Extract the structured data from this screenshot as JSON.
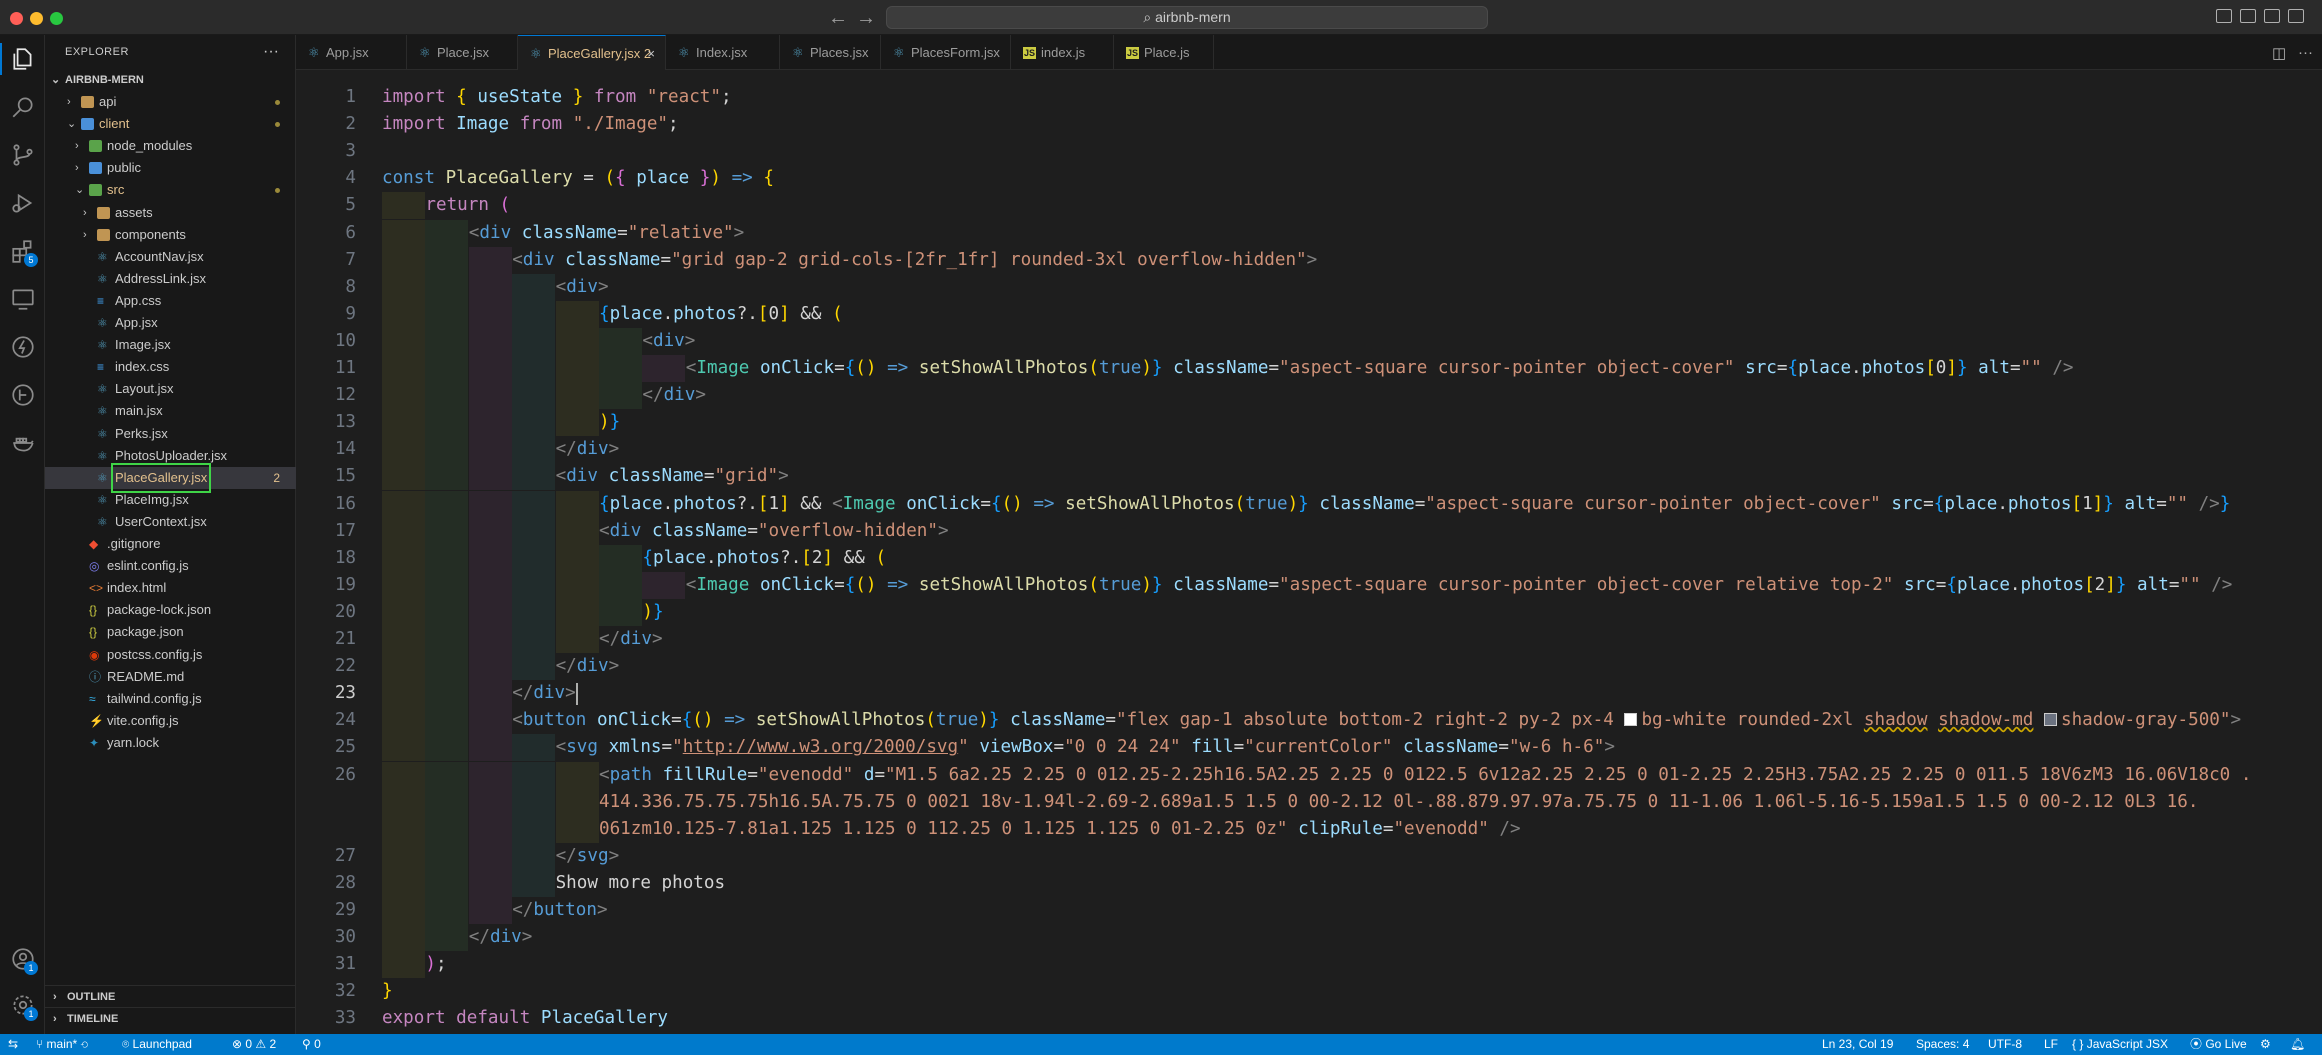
{
  "window": {
    "search_text": "airbnb-mern"
  },
  "activity_bar": {
    "extensions_badge": "5",
    "accounts_badge": "1",
    "settings_badge": "1"
  },
  "sidebar": {
    "title": "EXPLORER",
    "root": "AIRBNB-MERN",
    "tree": [
      {
        "label": "api",
        "kind": "folder",
        "color": "folder",
        "depth": 1,
        "chev": "›",
        "dot": true
      },
      {
        "label": "client",
        "kind": "folder",
        "color": "folder-blue",
        "depth": 1,
        "chev": "⌄",
        "dot": true,
        "mod": true
      },
      {
        "label": "node_modules",
        "kind": "folder",
        "color": "folder-green",
        "depth": 2,
        "chev": "›"
      },
      {
        "label": "public",
        "kind": "folder",
        "color": "folder-blue",
        "depth": 2,
        "chev": "›"
      },
      {
        "label": "src",
        "kind": "folder",
        "color": "folder-green",
        "depth": 2,
        "chev": "⌄",
        "dot": true,
        "mod": true
      },
      {
        "label": "assets",
        "kind": "folder",
        "color": "folder",
        "depth": 3,
        "chev": "›"
      },
      {
        "label": "components",
        "kind": "folder",
        "color": "folder",
        "depth": 3,
        "chev": "›"
      },
      {
        "label": "AccountNav.jsx",
        "kind": "react",
        "depth": 3
      },
      {
        "label": "AddressLink.jsx",
        "kind": "react",
        "depth": 3
      },
      {
        "label": "App.css",
        "kind": "css",
        "depth": 3
      },
      {
        "label": "App.jsx",
        "kind": "react",
        "depth": 3
      },
      {
        "label": "Image.jsx",
        "kind": "react",
        "depth": 3
      },
      {
        "label": "index.css",
        "kind": "css",
        "depth": 3
      },
      {
        "label": "Layout.jsx",
        "kind": "react",
        "depth": 3
      },
      {
        "label": "main.jsx",
        "kind": "react",
        "depth": 3
      },
      {
        "label": "Perks.jsx",
        "kind": "react",
        "depth": 3
      },
      {
        "label": "PhotosUploader.jsx",
        "kind": "react",
        "depth": 3
      },
      {
        "label": "PlaceGallery.jsx",
        "kind": "react",
        "depth": 3,
        "selected": true,
        "count": "2"
      },
      {
        "label": "PlaceImg.jsx",
        "kind": "react",
        "depth": 3
      },
      {
        "label": "UserContext.jsx",
        "kind": "react",
        "depth": 3
      },
      {
        "label": ".gitignore",
        "kind": "git",
        "depth": 2
      },
      {
        "label": "eslint.config.js",
        "kind": "eslint",
        "depth": 2
      },
      {
        "label": "index.html",
        "kind": "html",
        "depth": 2
      },
      {
        "label": "package-lock.json",
        "kind": "json",
        "depth": 2
      },
      {
        "label": "package.json",
        "kind": "json",
        "depth": 2
      },
      {
        "label": "postcss.config.js",
        "kind": "postcss",
        "depth": 2
      },
      {
        "label": "README.md",
        "kind": "md",
        "depth": 2
      },
      {
        "label": "tailwind.config.js",
        "kind": "tailwind",
        "depth": 2
      },
      {
        "label": "vite.config.js",
        "kind": "vite",
        "depth": 2
      },
      {
        "label": "yarn.lock",
        "kind": "yarn",
        "depth": 2
      }
    ],
    "outline_label": "OUTLINE",
    "timeline_label": "TIMELINE"
  },
  "tabs": [
    {
      "label": "App.jsx",
      "icon": "react"
    },
    {
      "label": "Place.jsx",
      "icon": "react"
    },
    {
      "label": "PlaceGallery.jsx 2",
      "icon": "react",
      "active": true
    },
    {
      "label": "Index.jsx",
      "icon": "react"
    },
    {
      "label": "Places.jsx",
      "icon": "react"
    },
    {
      "label": "PlacesForm.jsx",
      "icon": "react"
    },
    {
      "label": "index.js",
      "icon": "js"
    },
    {
      "label": "Place.js",
      "icon": "js"
    }
  ],
  "editor": {
    "current_line": 23,
    "lines": [
      {
        "n": 1,
        "depth": 0,
        "html": "<span class=\"k\">import</span> <span class=\"b1\">{</span> <span class=\"v\">useState</span> <span class=\"b1\">}</span> <span class=\"k\">from</span> <span class=\"s\">\"react\"</span>;"
      },
      {
        "n": 2,
        "depth": 0,
        "html": "<span class=\"k\">import</span> <span class=\"v\">Image</span> <span class=\"k\">from</span> <span class=\"s\">\"./Image\"</span>;"
      },
      {
        "n": 3,
        "depth": 0,
        "html": ""
      },
      {
        "n": 4,
        "depth": 0,
        "html": "<span class=\"kb\">const</span> <span class=\"f\">PlaceGallery</span> = <span class=\"b1\">(</span><span class=\"b2\">{</span> <span class=\"v\">place</span> <span class=\"b2\">}</span><span class=\"b1\">)</span> <span class=\"kb\">=&gt;</span> <span class=\"b1\">{</span>"
      },
      {
        "n": 5,
        "depth": 1,
        "html": "<span class=\"k\">return</span> <span class=\"b2\">(</span>"
      },
      {
        "n": 6,
        "depth": 2,
        "html": "<span class=\"tg\">&lt;</span><span class=\"tn\">div</span> <span class=\"at\">className</span>=<span class=\"s\">\"relative\"</span><span class=\"tg\">&gt;</span>"
      },
      {
        "n": 7,
        "depth": 3,
        "html": "<span class=\"tg\">&lt;</span><span class=\"tn\">div</span> <span class=\"at\">className</span>=<span class=\"s\">\"grid gap-2 grid-cols-[2fr_1fr] rounded-3xl overflow-hidden\"</span><span class=\"tg\">&gt;</span>"
      },
      {
        "n": 8,
        "depth": 4,
        "html": "<span class=\"tg\">&lt;</span><span class=\"tn\">div</span><span class=\"tg\">&gt;</span>"
      },
      {
        "n": 9,
        "depth": 5,
        "html": "<span class=\"b3\">{</span><span class=\"v\">place</span>.<span class=\"v\">photos</span>?.<span class=\"b1\">[</span>0<span class=\"b1\">]</span> &amp;&amp; <span class=\"b1\">(</span>"
      },
      {
        "n": 10,
        "depth": 6,
        "html": "<span class=\"tg\">&lt;</span><span class=\"tn\">div</span><span class=\"tg\">&gt;</span>"
      },
      {
        "n": 11,
        "depth": 7,
        "html": "<span class=\"tg\">&lt;</span><span class=\"tc\">Image</span> <span class=\"at\">onClick</span>=<span class=\"b3\">{</span><span class=\"b1\">()</span> <span class=\"kb\">=&gt;</span> <span class=\"f\">setShowAllPhotos</span><span class=\"b1\">(</span><span class=\"kb\">true</span><span class=\"b1\">)</span><span class=\"b3\">}</span> <span class=\"at\">className</span>=<span class=\"s\">\"aspect-square cursor-pointer object-cover\"</span> <span class=\"at\">src</span>=<span class=\"b3\">{</span><span class=\"v\">place</span>.<span class=\"v\">photos</span><span class=\"b1\">[</span>0<span class=\"b1\">]</span><span class=\"b3\">}</span> <span class=\"at\">alt</span>=<span class=\"s\">\"\"</span> <span class=\"tg\">/&gt;</span>"
      },
      {
        "n": 12,
        "depth": 6,
        "html": "<span class=\"tg\">&lt;/</span><span class=\"tn\">div</span><span class=\"tg\">&gt;</span>"
      },
      {
        "n": 13,
        "depth": 5,
        "html": "<span class=\"b1\">)</span><span class=\"b3\">}</span>"
      },
      {
        "n": 14,
        "depth": 4,
        "html": "<span class=\"tg\">&lt;/</span><span class=\"tn\">div</span><span class=\"tg\">&gt;</span>"
      },
      {
        "n": 15,
        "depth": 4,
        "html": "<span class=\"tg\">&lt;</span><span class=\"tn\">div</span> <span class=\"at\">className</span>=<span class=\"s\">\"grid\"</span><span class=\"tg\">&gt;</span>"
      },
      {
        "n": 16,
        "depth": 5,
        "html": "<span class=\"b3\">{</span><span class=\"v\">place</span>.<span class=\"v\">photos</span>?.<span class=\"b1\">[</span>1<span class=\"b1\">]</span> &amp;&amp; <span class=\"tg\">&lt;</span><span class=\"tc\">Image</span> <span class=\"at\">onClick</span>=<span class=\"b3\">{</span><span class=\"b1\">()</span> <span class=\"kb\">=&gt;</span> <span class=\"f\">setShowAllPhotos</span><span class=\"b1\">(</span><span class=\"kb\">true</span><span class=\"b1\">)</span><span class=\"b3\">}</span> <span class=\"at\">className</span>=<span class=\"s\">\"aspect-square cursor-pointer object-cover\"</span> <span class=\"at\">src</span>=<span class=\"b3\">{</span><span class=\"v\">place</span>.<span class=\"v\">photos</span><span class=\"b1\">[</span>1<span class=\"b1\">]</span><span class=\"b3\">}</span> <span class=\"at\">alt</span>=<span class=\"s\">\"\"</span> <span class=\"tg\">/&gt;</span><span class=\"b3\">}</span>"
      },
      {
        "n": 17,
        "depth": 5,
        "html": "<span class=\"tg\">&lt;</span><span class=\"tn\">div</span> <span class=\"at\">className</span>=<span class=\"s\">\"overflow-hidden\"</span><span class=\"tg\">&gt;</span>"
      },
      {
        "n": 18,
        "depth": 6,
        "html": "<span class=\"b3\">{</span><span class=\"v\">place</span>.<span class=\"v\">photos</span>?.<span class=\"b1\">[</span>2<span class=\"b1\">]</span> &amp;&amp; <span class=\"b1\">(</span>"
      },
      {
        "n": 19,
        "depth": 7,
        "html": "<span class=\"tg\">&lt;</span><span class=\"tc\">Image</span> <span class=\"at\">onClick</span>=<span class=\"b3\">{</span><span class=\"b1\">()</span> <span class=\"kb\">=&gt;</span> <span class=\"f\">setShowAllPhotos</span><span class=\"b1\">(</span><span class=\"kb\">true</span><span class=\"b1\">)</span><span class=\"b3\">}</span> <span class=\"at\">className</span>=<span class=\"s\">\"aspect-square cursor-pointer object-cover relative top-2\"</span> <span class=\"at\">src</span>=<span class=\"b3\">{</span><span class=\"v\">place</span>.<span class=\"v\">photos</span><span class=\"b1\">[</span>2<span class=\"b1\">]</span><span class=\"b3\">}</span> <span class=\"at\">alt</span>=<span class=\"s\">\"\"</span> <span class=\"tg\">/&gt;</span>"
      },
      {
        "n": 20,
        "depth": 6,
        "html": "<span class=\"b1\">)</span><span class=\"b3\">}</span>"
      },
      {
        "n": 21,
        "depth": 5,
        "html": "<span class=\"tg\">&lt;/</span><span class=\"tn\">div</span><span class=\"tg\">&gt;</span>"
      },
      {
        "n": 22,
        "depth": 4,
        "html": "<span class=\"tg\">&lt;/</span><span class=\"tn\">div</span><span class=\"tg\">&gt;</span>"
      },
      {
        "n": 23,
        "depth": 3,
        "html": "<span class=\"tg\">&lt;/</span><span class=\"tn\">div</span><span class=\"tg\">&gt;</span>"
      },
      {
        "n": 24,
        "depth": 3,
        "html": "<span class=\"tg\">&lt;</span><span class=\"tn\">button</span> <span class=\"at\">onClick</span>=<span class=\"b3\">{</span><span class=\"b1\">()</span> <span class=\"kb\">=&gt;</span> <span class=\"f\">setShowAllPhotos</span><span class=\"b1\">(</span><span class=\"kb\">true</span><span class=\"b1\">)</span><span class=\"b3\">}</span> <span class=\"at\">className</span>=<span class=\"s\">\"flex gap-1 absolute bottom-2 right-2 py-2 px-4 <span class=\"swatch\" style=\"background:#ffffff\"></span>bg-white rounded-2xl <span class=\"sq\">shadow</span> <span class=\"sq\">shadow-md</span> <span class=\"swatch\" style=\"background:#6b7280\"></span>shadow-gray-500\"</span><span class=\"tg\">&gt;</span>"
      },
      {
        "n": 25,
        "depth": 4,
        "html": "<span class=\"tg\">&lt;</span><span class=\"tn\">svg</span> <span class=\"at\">xmlns</span>=<span class=\"s\">\"<span class=\"u\">http://www.w3.org/2000/svg</span>\"</span> <span class=\"at\">viewBox</span>=<span class=\"s\">\"0 0 24 24\"</span> <span class=\"at\">fill</span>=<span class=\"s\">\"currentColor\"</span> <span class=\"at\">className</span>=<span class=\"s\">\"w-6 h-6\"</span><span class=\"tg\">&gt;</span>"
      },
      {
        "n": 26,
        "depth": 5,
        "html": "<span class=\"tg\">&lt;</span><span class=\"tn\">path</span> <span class=\"at\">fillRule</span>=<span class=\"s\">\"evenodd\"</span> <span class=\"at\">d</span>=<span class=\"s\">\"M1.5 6a2.25 2.25 0 012.25-2.25h16.5A2.25 2.25 0 0122.5 6v12a2.25 2.25 0 01-2.25 2.25H3.75A2.25 2.25 0 011.5 18V6zM3 16.06V18c0 .</span>"
      },
      {
        "n": null,
        "depth": 5,
        "html": "<span class=\"s\">414.336.75.75.75h16.5A.75.75 0 0021 18v-1.94l-2.69-2.689a1.5 1.5 0 00-2.12 0l-.88.879.97.97a.75.75 0 11-1.06 1.06l-5.16-5.159a1.5 1.5 0 00-2.12 0L3 16.</span>"
      },
      {
        "n": null,
        "depth": 5,
        "html": "<span class=\"s\">061zm10.125-7.81a1.125 1.125 0 112.25 0 1.125 1.125 0 01-2.25 0z\"</span> <span class=\"at\">clipRule</span>=<span class=\"s\">\"evenodd\"</span> <span class=\"tg\">/&gt;</span>"
      },
      {
        "n": 27,
        "depth": 4,
        "html": "<span class=\"tg\">&lt;/</span><span class=\"tn\">svg</span><span class=\"tg\">&gt;</span>"
      },
      {
        "n": 28,
        "depth": 4,
        "html": "<span class=\"tx\">Show more photos</span>"
      },
      {
        "n": 29,
        "depth": 3,
        "html": "<span class=\"tg\">&lt;/</span><span class=\"tn\">button</span><span class=\"tg\">&gt;</span>"
      },
      {
        "n": 30,
        "depth": 2,
        "html": "<span class=\"tg\">&lt;/</span><span class=\"tn\">div</span><span class=\"tg\">&gt;</span>"
      },
      {
        "n": 31,
        "depth": 1,
        "html": "<span class=\"b2\">)</span>;"
      },
      {
        "n": 32,
        "depth": 0,
        "html": "<span class=\"b1\">}</span>"
      },
      {
        "n": 33,
        "depth": 0,
        "html": "<span class=\"k\">export</span> <span class=\"k\">default</span> <span class=\"v\">PlaceGallery</span>"
      }
    ]
  },
  "statusbar": {
    "branch": "main*",
    "launchpad": "Launchpad",
    "errors": "0",
    "warnings": "2",
    "ports": "0",
    "position": "Ln 23, Col 19",
    "spaces": "Spaces: 4",
    "encoding": "UTF-8",
    "eol": "LF",
    "language": "JavaScript JSX",
    "golive": "Go Live"
  }
}
